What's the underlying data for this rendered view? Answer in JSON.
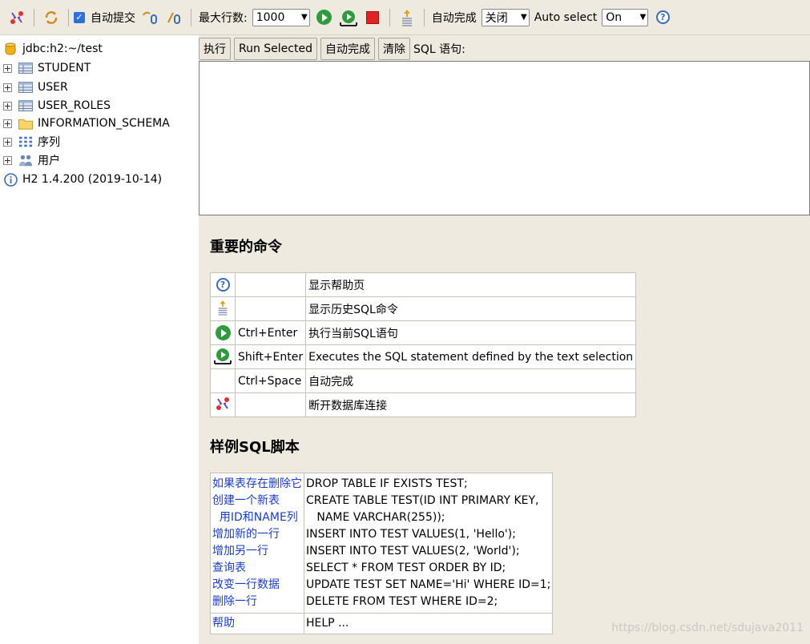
{
  "toolbar": {
    "autocommit_label": "自动提交",
    "max_rows_label": "最大行数:",
    "max_rows_value": "1000",
    "autocomplete_label": "自动完成",
    "autocomplete_value": "关闭",
    "autoselect_label": "Auto select",
    "autoselect_value": "On"
  },
  "tree": {
    "connection": "jdbc:h2:~/test",
    "items": [
      {
        "label": "STUDENT",
        "icon": "table-icon"
      },
      {
        "label": "USER",
        "icon": "table-icon"
      },
      {
        "label": "USER_ROLES",
        "icon": "table-icon"
      },
      {
        "label": "INFORMATION_SCHEMA",
        "icon": "folder-icon"
      },
      {
        "label": "序列",
        "icon": "sequence-icon"
      },
      {
        "label": "用户",
        "icon": "users-icon"
      }
    ],
    "version": "H2 1.4.200 (2019-10-14)"
  },
  "query": {
    "execute": "执行",
    "run_selected": "Run Selected",
    "autocomplete": "自动完成",
    "clear": "清除",
    "sql_label": "SQL 语句:"
  },
  "important": {
    "title": "重要的命令",
    "rows": [
      {
        "icon": "help-icon",
        "key": "",
        "desc": "显示帮助页"
      },
      {
        "icon": "history-icon",
        "key": "",
        "desc": "显示历史SQL命令"
      },
      {
        "icon": "run-icon",
        "key": "Ctrl+Enter",
        "desc": "执行当前SQL语句"
      },
      {
        "icon": "run-selected-icon",
        "key": "Shift+Enter",
        "desc": "Executes the SQL statement defined by the text selection"
      },
      {
        "icon": "",
        "key": "Ctrl+Space",
        "desc": "自动完成"
      },
      {
        "icon": "disconnect-icon",
        "key": "",
        "desc": "断开数据库连接"
      }
    ]
  },
  "sample": {
    "title": "样例SQL脚本",
    "rows": [
      {
        "link": "如果表存在删除它",
        "code": "DROP TABLE IF EXISTS TEST;"
      },
      {
        "link": "创建一个新表",
        "code": "CREATE TABLE TEST(ID INT PRIMARY KEY,"
      },
      {
        "link": "  用ID和NAME列",
        "code": "   NAME VARCHAR(255));"
      },
      {
        "link": "增加新的一行",
        "code": "INSERT INTO TEST VALUES(1, 'Hello');"
      },
      {
        "link": "增加另一行",
        "code": "INSERT INTO TEST VALUES(2, 'World');"
      },
      {
        "link": "查询表",
        "code": "SELECT * FROM TEST ORDER BY ID;"
      },
      {
        "link": "改变一行数据",
        "code": "UPDATE TEST SET NAME='Hi' WHERE ID=1;"
      },
      {
        "link": "删除一行",
        "code": "DELETE FROM TEST WHERE ID=2;"
      }
    ],
    "help_link": "帮助",
    "help_code": "HELP ..."
  },
  "watermark": "https://blog.csdn.net/sdujava2011"
}
